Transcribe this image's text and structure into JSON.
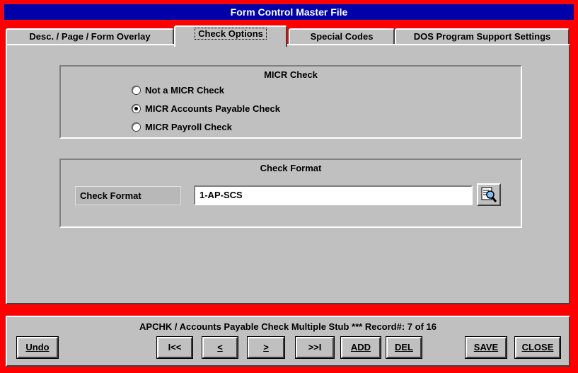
{
  "window": {
    "title": "Form Control Master File"
  },
  "tabs": [
    {
      "label": "Desc. / Page / Form Overlay"
    },
    {
      "label": "Check Options"
    },
    {
      "label": "Special Codes"
    },
    {
      "label": "DOS Program Support Settings"
    }
  ],
  "micr": {
    "title": "MICR Check",
    "options": [
      {
        "label": "Not a MICR Check",
        "selected": false
      },
      {
        "label": "MICR Accounts Payable Check",
        "selected": true
      },
      {
        "label": "MICR Payroll Check",
        "selected": false
      }
    ]
  },
  "check_format": {
    "title": "Check Format",
    "field_label": "Check Format",
    "value": "1-AP-SCS"
  },
  "footer": {
    "status": "APCHK / Accounts Payable Check Multiple Stub *** Record#:  7 of  16",
    "buttons": {
      "undo": "Undo",
      "first": "I<<",
      "prev": "<",
      "next": ">",
      "last": ">>I",
      "add": "ADD",
      "del": "DEL",
      "save": "SAVE",
      "close": "CLOSE"
    }
  },
  "colors": {
    "frame": "#ff0000",
    "titlebar": "#0000a8",
    "face": "#c0c0c0"
  }
}
